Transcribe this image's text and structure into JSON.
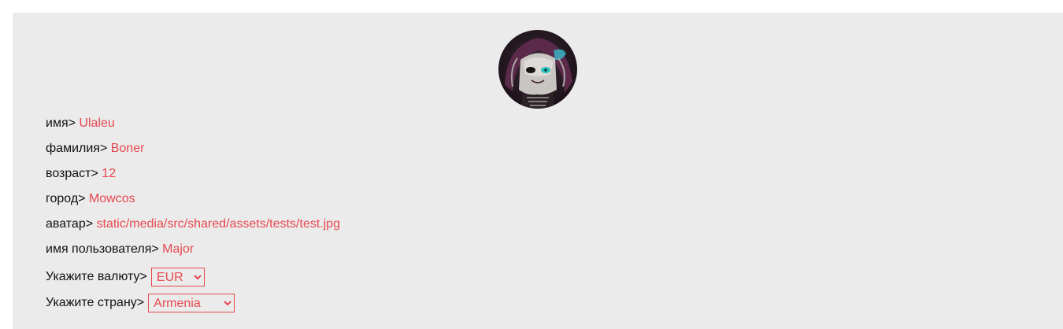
{
  "profile": {
    "avatar_icon": "user-avatar-picture",
    "fields": {
      "name": {
        "label": "имя> ",
        "value": "Ulaleu"
      },
      "surname": {
        "label": "фамилия> ",
        "value": "Boner"
      },
      "age": {
        "label": "возраст> ",
        "value": "12"
      },
      "city": {
        "label": "город> ",
        "value": "Mowcos"
      },
      "avatar": {
        "label": "аватар> ",
        "value": "static/media/src/shared/assets/tests/test.jpg"
      },
      "username": {
        "label": "имя пользователя> ",
        "value": "Major"
      }
    },
    "currency": {
      "label": "Укажите валюту>",
      "selected": "EUR"
    },
    "country": {
      "label": "Укажите страну>",
      "selected": "Armenia"
    }
  },
  "colors": {
    "background": "#ebebeb",
    "accent": "#e8484f",
    "text": "#111111"
  }
}
